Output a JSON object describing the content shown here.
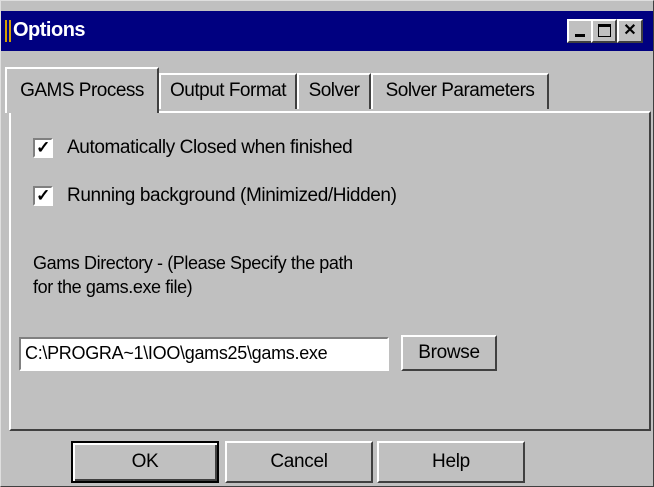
{
  "window": {
    "title": "Options"
  },
  "tabs": [
    {
      "label": "GAMS Process",
      "mnemonic": "G",
      "active": true
    },
    {
      "label": "Output Format",
      "mnemonic": "O",
      "active": false
    },
    {
      "label": "Solver",
      "mnemonic": "",
      "active": false
    },
    {
      "label": "Solver Parameters",
      "mnemonic": "",
      "active": false
    }
  ],
  "options": {
    "auto_close": {
      "label": "Automatically Closed when finished",
      "checked": true
    },
    "background": {
      "label": "Running background (Minimized/Hidden)",
      "checked": true
    }
  },
  "directory": {
    "description_line1": "Gams Directory - (Please Specify the path",
    "description_line2": "for the gams.exe file)",
    "path_value": "C:\\PROGRA~1\\IOO\\gams25\\gams.exe",
    "browse_label": "Browse"
  },
  "footer": {
    "ok_label": "OK",
    "cancel_label": "Cancel",
    "help_label": "Help"
  },
  "colors": {
    "titlebar": "#000080",
    "face": "#c0c0c0"
  }
}
